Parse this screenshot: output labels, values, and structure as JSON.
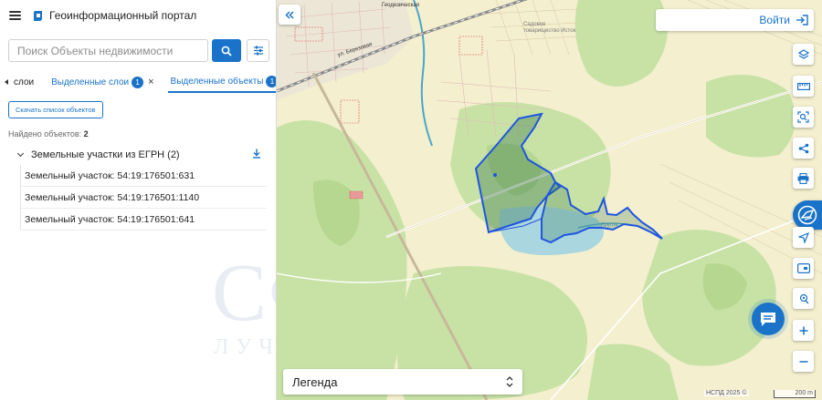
{
  "header": {
    "title": "Геоинформационный портал"
  },
  "search": {
    "placeholder": "Поиск Объекты недвижимости"
  },
  "tabs": [
    {
      "label": "слои"
    },
    {
      "label": "Выделенные слои",
      "badge": "1",
      "close": "×"
    },
    {
      "label": "Выделенные объекты",
      "badge": "1",
      "close": "×"
    }
  ],
  "panel": {
    "download_list_label": "Скачать список объектов",
    "found_label": "Найдено объектов:",
    "found_count": "2",
    "group_label": "Земельные участки из ЕГРН (2)",
    "items": [
      {
        "label": "Земельный участок: 54:19:176501:631"
      },
      {
        "label": "Земельный участок: 54:19:176501:1140"
      },
      {
        "label": "Земельный участок: 54:19:176501:641"
      }
    ]
  },
  "watermark": {
    "main": "СФЕРА",
    "sub": "ЛУЧШЕЕ ВОЗМОЖНОСТИ"
  },
  "map": {
    "login_label": "Войти",
    "legend_label": "Легенда",
    "attribution": "НСПД 2025 ©",
    "scale_label": "200 m",
    "labels": {
      "village": "Садовое товарищество Исток",
      "street": "ул. Березовая",
      "road": "Геодезическая",
      "creek": "Кругле"
    }
  },
  "colors": {
    "accent": "#1a73c9",
    "parcel_outline": "#1f55e0",
    "forest": "#c8e2a6",
    "map_bg": "#f4efcf"
  },
  "icons": {
    "toolbar": [
      "layers-icon",
      "ruler-icon",
      "select-area-icon",
      "share-icon",
      "print-icon",
      "cadastre-icon",
      "navigate-icon",
      "widget-icon",
      "location-icon",
      "zoom-in-icon",
      "zoom-out-icon"
    ]
  }
}
